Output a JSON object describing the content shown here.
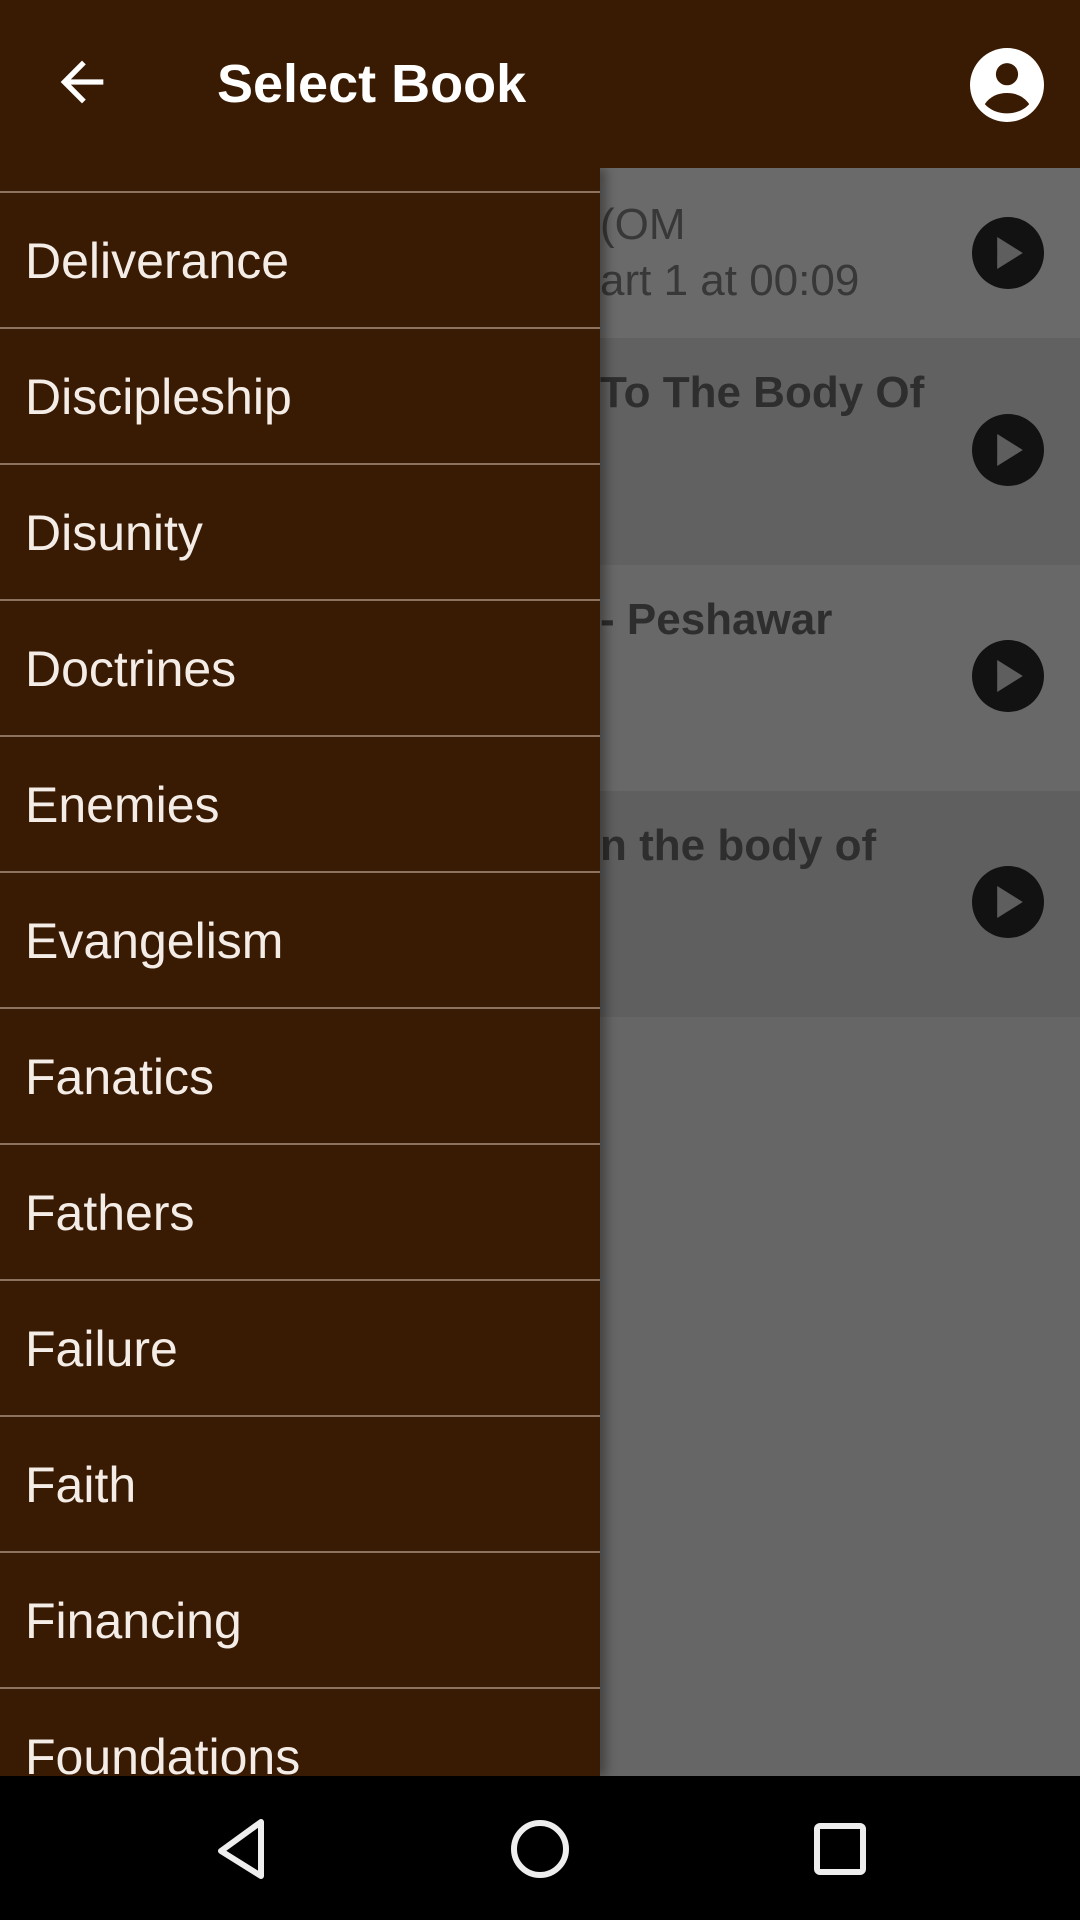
{
  "appbar": {
    "title": "Select Book",
    "back_icon": "arrow-left-icon",
    "account_icon": "account-circle-icon"
  },
  "colors": {
    "primary": "#391a02",
    "divider": "#8c7360",
    "drawer_text": "#f4ece6"
  },
  "background_list": [
    {
      "title": "(OM",
      "subtitle": "art 1 at 00:09"
    },
    {
      "title": "To The Body Of",
      "subtitle": ""
    },
    {
      "title": "- Peshawar",
      "subtitle": ""
    },
    {
      "title": "n the body of",
      "subtitle": ""
    }
  ],
  "drawer": {
    "items": [
      {
        "label": ""
      },
      {
        "label": "Deliverance"
      },
      {
        "label": "Discipleship"
      },
      {
        "label": "Disunity"
      },
      {
        "label": "Doctrines"
      },
      {
        "label": "Enemies"
      },
      {
        "label": "Evangelism"
      },
      {
        "label": "Fanatics"
      },
      {
        "label": "Fathers"
      },
      {
        "label": "Failure"
      },
      {
        "label": "Faith"
      },
      {
        "label": "Financing"
      },
      {
        "label": "Foundations"
      }
    ]
  },
  "navbar": {
    "back": "nav-back-icon",
    "home": "nav-home-icon",
    "recents": "nav-recents-icon"
  }
}
